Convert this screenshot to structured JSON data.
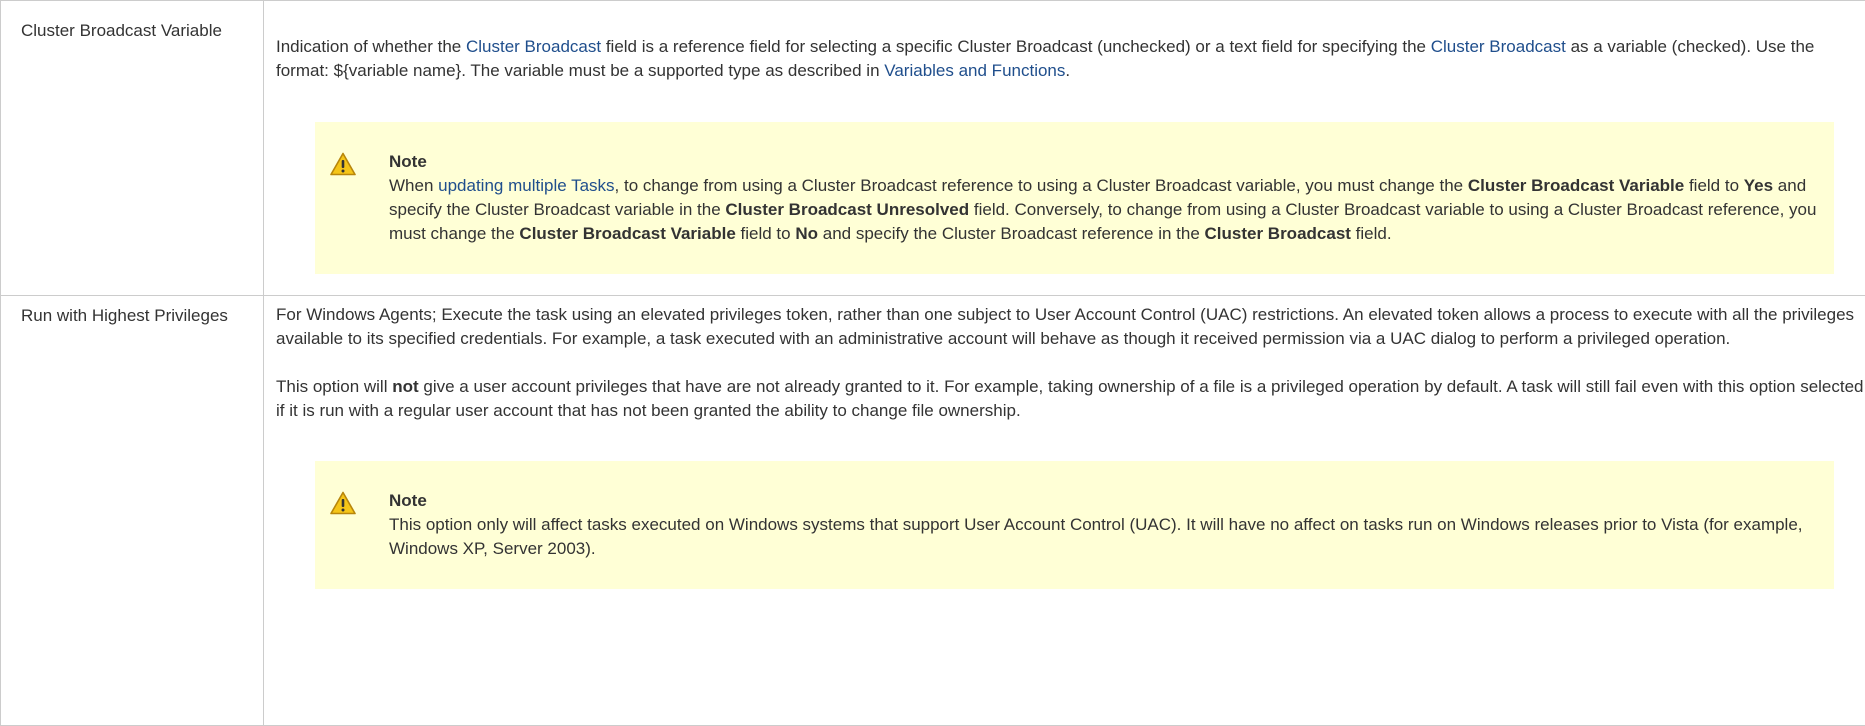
{
  "rows": [
    {
      "label": "Cluster Broadcast Variable",
      "description": {
        "t1": "Indication of whether the ",
        "link1": "Cluster Broadcast",
        "t2": " field is a reference field for selecting a specific Cluster Broadcast (unchecked) or a text field for specifying the ",
        "link2": "Cluster Broadcast",
        "t3": " as a variable (checked). Use the format: ${variable name}. The variable must be a supported type as described in ",
        "link3": "Variables and Functions",
        "t4": "."
      },
      "note": {
        "title": "Note",
        "t1": "When ",
        "link1": "updating multiple Tasks",
        "t2": ", to change from using a Cluster Broadcast reference to using a Cluster Broadcast variable, you must change the ",
        "b1": "Cluster Broadcast Variable",
        "t3": " field to ",
        "b2": "Yes",
        "t4": " and specify the Cluster Broadcast variable in the ",
        "b3": "Cluster Broadcast Unresolved",
        "t5": " field. Conversely, to change from using a Cluster Broadcast variable to using a Cluster Broadcast reference, you must change the ",
        "b4": "Cluster Broadcast Variable",
        "t6": " field to ",
        "b5": "No",
        "t7": " and specify the Cluster Broadcast reference in the ",
        "b6": "Cluster Broadcast",
        "t8": " field."
      }
    },
    {
      "label": "Run with Highest Privileges",
      "paragraph1": "For Windows Agents; Execute the task using an elevated privileges token, rather than one subject to User Account Control (UAC) restrictions. An elevated token allows a process to execute with all the privileges available to its specified credentials. For example, a task executed with an administrative account will behave as though it received permission via a UAC dialog to perform a privileged operation.",
      "paragraph2": {
        "t1": "This option will ",
        "b1": "not",
        "t2": " give a user account privileges that have are not already granted to it. For example, taking ownership of a file is a privileged operation by default. A task will still fail even with this option selected if it is run with a regular user account that has not been granted the ability to change file ownership."
      },
      "note": {
        "title": "Note",
        "text": "This option only will affect tasks executed on Windows systems that support User Account Control (UAC). It will have no affect on tasks run on Windows releases prior to Vista (for example, Windows XP, Server 2003)."
      }
    }
  ],
  "colors": {
    "link": "#1f4e8c",
    "note_background": "#ffffd6",
    "warning_icon": "#f5c518",
    "border": "#cccccc"
  },
  "icons": [
    "warning-icon"
  ]
}
